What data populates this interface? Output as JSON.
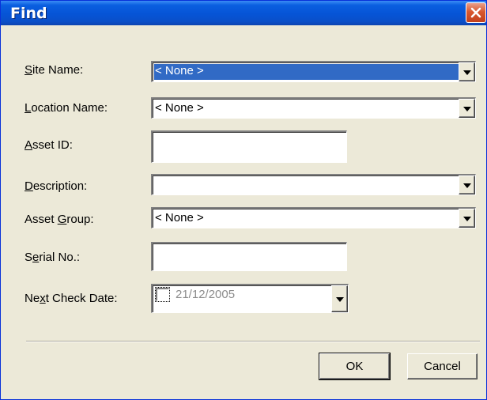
{
  "window": {
    "title": "Find"
  },
  "fields": [
    {
      "label_pre": "",
      "label_key": "S",
      "label_post": "ite Name:",
      "type": "combo",
      "value": "< None >",
      "selected": true
    },
    {
      "label_pre": "",
      "label_key": "L",
      "label_post": "ocation Name:",
      "type": "combo",
      "value": "< None >"
    },
    {
      "label_pre": "",
      "label_key": "A",
      "label_post": "sset ID:",
      "type": "text",
      "value": ""
    },
    {
      "label_pre": "",
      "label_key": "D",
      "label_post": "escription:",
      "type": "combo",
      "value": ""
    },
    {
      "label_pre": "Asset ",
      "label_key": "G",
      "label_post": "roup:",
      "type": "combo",
      "value": "< None >"
    },
    {
      "label_pre": "S",
      "label_key": "e",
      "label_post": "rial No.:",
      "type": "text",
      "value": ""
    },
    {
      "label_pre": "Ne",
      "label_key": "x",
      "label_post": "t Check Date:",
      "type": "date",
      "value": "21/12/2005",
      "checked": false
    }
  ],
  "buttons": {
    "ok": "OK",
    "cancel": "Cancel"
  }
}
